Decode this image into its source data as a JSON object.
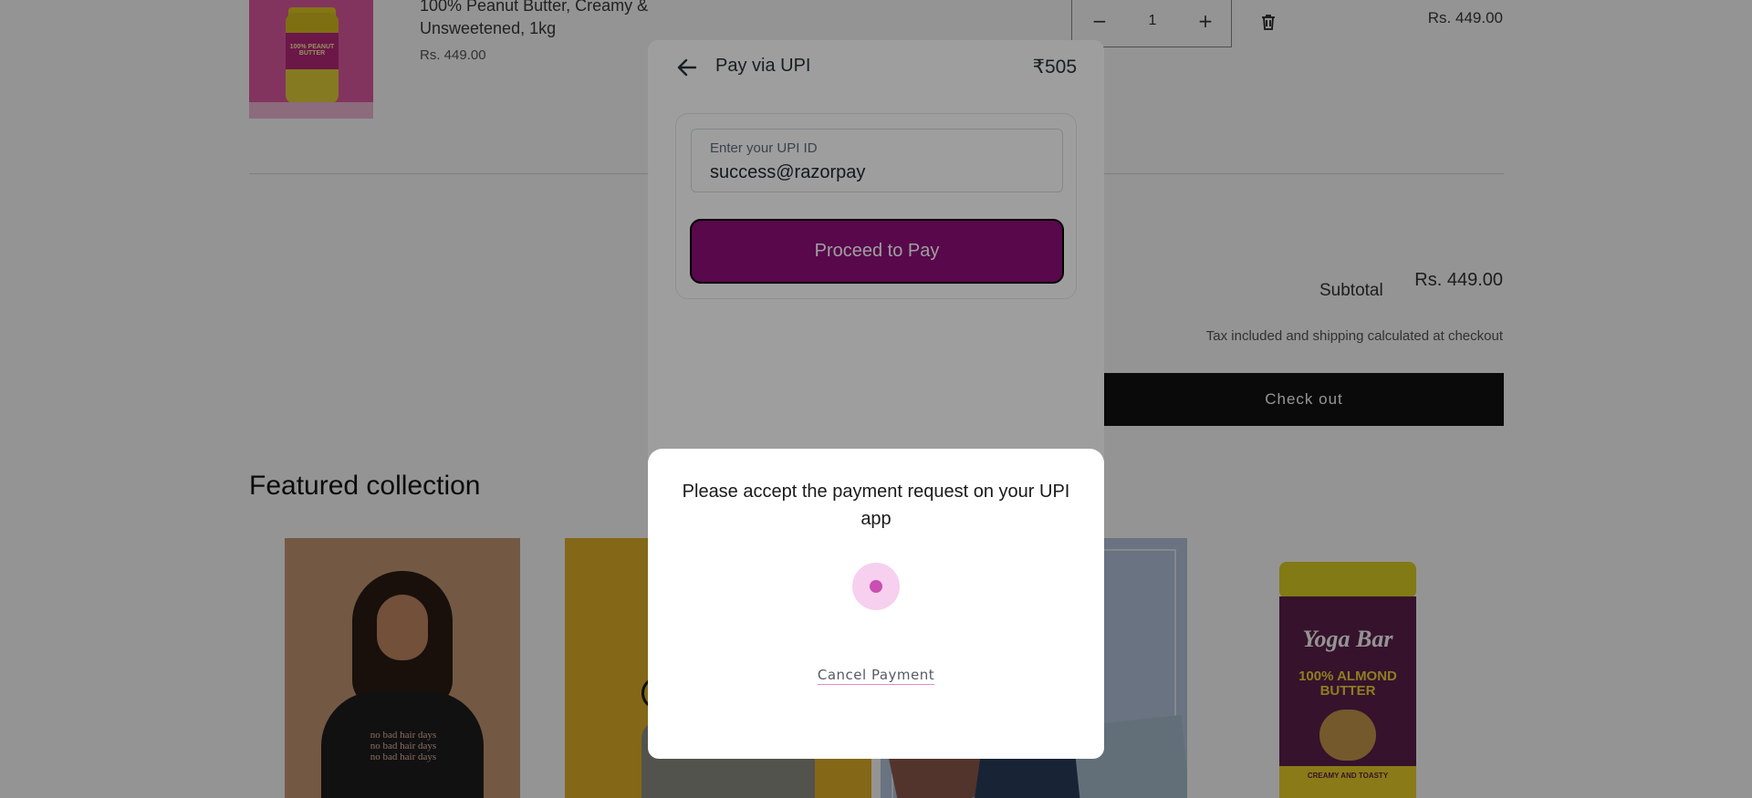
{
  "cart": {
    "product_image_label": "100% PEANUT BUTTER",
    "product_name": "100% Peanut Butter, Creamy & Unsweetened, 1kg",
    "product_price": "Rs. 449.00",
    "quantity": "1",
    "minus_label": "−",
    "plus_label": "+",
    "line_total": "Rs. 449.00",
    "subtotal_label": "Subtotal",
    "subtotal_value": "Rs. 449.00",
    "tax_note": "Tax included and shipping calculated at checkout",
    "checkout_label": "Check out"
  },
  "featured": {
    "title": "Featured collection",
    "cards": [
      {
        "name": "tee",
        "text": "no bad hair days\nno bad hair days\nno bad hair days"
      },
      {
        "name": "yellow-shirt",
        "text": ""
      },
      {
        "name": "fabric",
        "text": "e"
      },
      {
        "name": "almond-butter",
        "logo": "Yoga Bar",
        "label": "100% ALMOND BUTTER",
        "band": "CREAMY AND TOASTY"
      }
    ]
  },
  "modal": {
    "title": "Pay via UPI",
    "amount": "₹505",
    "upi_label": "Enter your UPI ID",
    "upi_value": "success@razorpay",
    "proceed_label": "Proceed to Pay"
  },
  "sheet": {
    "message": "Please accept the payment request on your UPI app",
    "cancel_label": "Cancel Payment"
  },
  "colors": {
    "razorpay_purple": "#8e0d79",
    "spinner_outer": "#f6d0ee",
    "spinner_inner": "#c94fb0"
  },
  "icons": {
    "back": "arrow-left-icon",
    "delete": "trash-icon"
  }
}
